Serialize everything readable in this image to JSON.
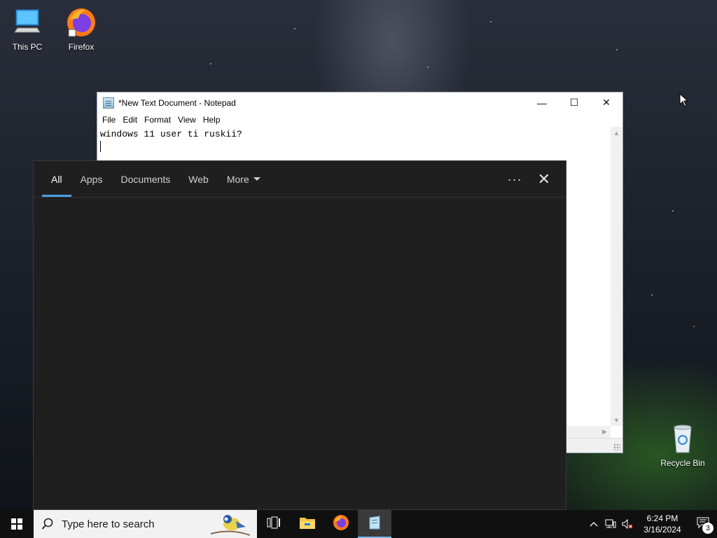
{
  "desktop": {
    "icons": [
      {
        "label": "This PC",
        "icon": "computer-icon"
      },
      {
        "label": "Firefox",
        "icon": "firefox-icon"
      },
      {
        "label": "Recycle Bin",
        "icon": "recycle-bin-icon"
      }
    ]
  },
  "notepad": {
    "title": "*New Text Document - Notepad",
    "menu": [
      "File",
      "Edit",
      "Format",
      "View",
      "Help"
    ],
    "content": "windows 11 user ti ruskii?",
    "controls": {
      "minimize": "—",
      "maximize": "☐",
      "close": "✕"
    }
  },
  "search_panel": {
    "tabs": [
      {
        "label": "All",
        "active": true
      },
      {
        "label": "Apps",
        "active": false
      },
      {
        "label": "Documents",
        "active": false
      },
      {
        "label": "Web",
        "active": false
      },
      {
        "label": "More",
        "active": false
      }
    ],
    "options_label": "···",
    "close_label": "✕",
    "accent": "#4a9fe8"
  },
  "taskbar": {
    "search_placeholder": "Type here to search",
    "pinned": [
      "task-view-icon",
      "file-explorer-icon",
      "firefox-icon",
      "notepad-icon"
    ],
    "active_app": "notepad-icon",
    "clock_time": "6:24 PM",
    "clock_date": "3/16/2024",
    "notification_count": "3"
  }
}
